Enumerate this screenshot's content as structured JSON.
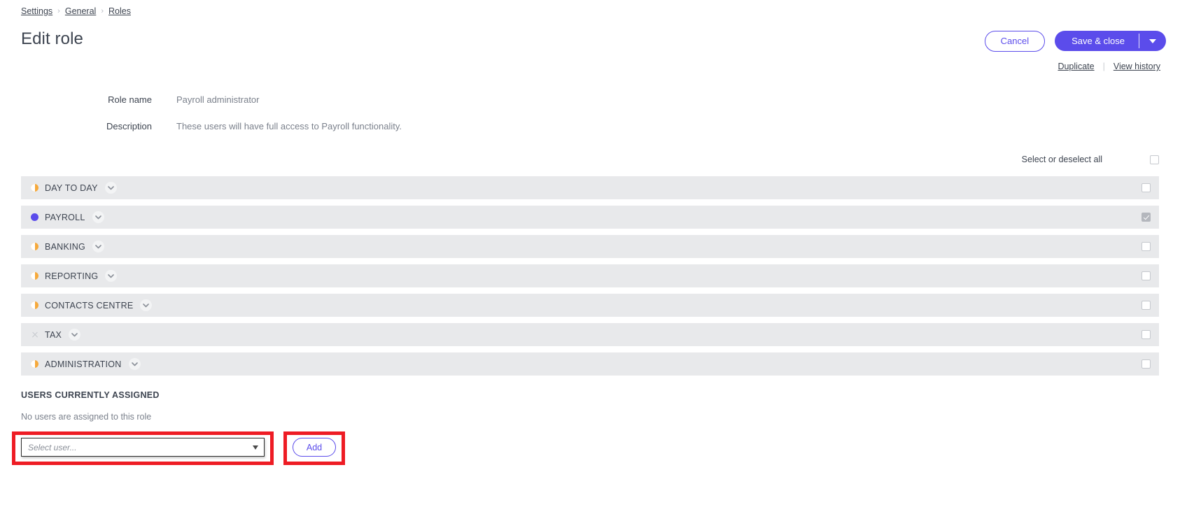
{
  "breadcrumb": {
    "items": [
      {
        "label": "Settings"
      },
      {
        "label": "General"
      },
      {
        "label": "Roles"
      }
    ],
    "separator": "›"
  },
  "header": {
    "title": "Edit role",
    "cancel_label": "Cancel",
    "save_label": "Save & close",
    "save_caret_icon": "chevron-down-icon",
    "duplicate_label": "Duplicate",
    "view_history_label": "View history",
    "link_separator": "|"
  },
  "form": {
    "role_name_label": "Role name",
    "role_name_value": "Payroll administrator",
    "description_label": "Description",
    "description_value": "These users will have full access to Payroll functionality."
  },
  "permissions": {
    "select_all_label": "Select or deselect all",
    "select_all_checked": false,
    "chevron_icon": "chevron-down-icon",
    "rows": [
      {
        "label": "DAY TO DAY",
        "status": "half",
        "status_icon": "half-circle-icon",
        "checked": false
      },
      {
        "label": "PAYROLL",
        "status": "full",
        "status_icon": "full-circle-icon",
        "checked": true
      },
      {
        "label": "BANKING",
        "status": "half",
        "status_icon": "half-circle-icon",
        "checked": false
      },
      {
        "label": "REPORTING",
        "status": "half",
        "status_icon": "half-circle-icon",
        "checked": false
      },
      {
        "label": "CONTACTS CENTRE",
        "status": "half",
        "status_icon": "half-circle-icon",
        "checked": false
      },
      {
        "label": "TAX",
        "status": "none",
        "status_icon": "cross-icon",
        "checked": false
      },
      {
        "label": "ADMINISTRATION",
        "status": "half",
        "status_icon": "half-circle-icon",
        "checked": false
      }
    ]
  },
  "users": {
    "heading": "USERS CURRENTLY ASSIGNED",
    "empty_text": "No users are assigned to this role",
    "select_placeholder": "Select user...",
    "select_value": "",
    "add_label": "Add"
  },
  "colors": {
    "accent": "#5b4ceb",
    "row_background": "#e8e9eb",
    "partial_status": "#f6a93b",
    "highlight": "#ee1c24"
  }
}
